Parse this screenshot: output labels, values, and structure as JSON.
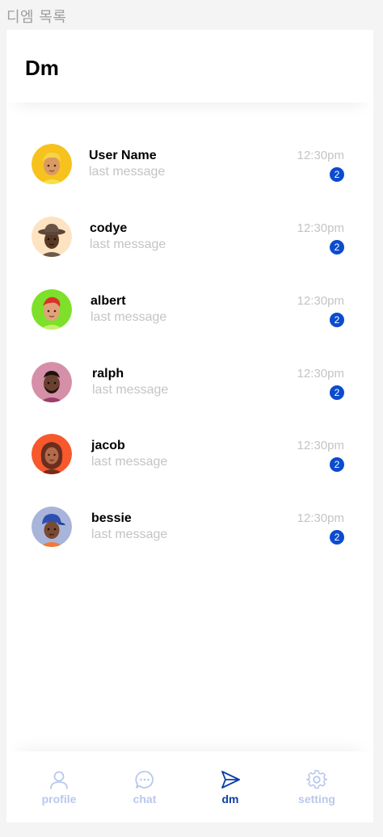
{
  "frame_label": "디엠 목록",
  "header": {
    "title": "Dm"
  },
  "conversations": [
    {
      "name": "User Name",
      "last_message": "last message",
      "time": "12:30pm",
      "unread": "2"
    },
    {
      "name": "codye",
      "last_message": "last message",
      "time": "12:30pm",
      "unread": "2"
    },
    {
      "name": "albert",
      "last_message": "last message",
      "time": "12:30pm",
      "unread": "2"
    },
    {
      "name": "ralph",
      "last_message": "last message",
      "time": "12:30pm",
      "unread": "2"
    },
    {
      "name": "jacob",
      "last_message": "last message",
      "time": "12:30pm",
      "unread": "2"
    },
    {
      "name": "bessie",
      "last_message": "last message",
      "time": "12:30pm",
      "unread": "2"
    }
  ],
  "nav": {
    "items": [
      {
        "label": "profile",
        "icon": "user-icon",
        "active": false
      },
      {
        "label": "chat",
        "icon": "chat-bubble-icon",
        "active": false
      },
      {
        "label": "dm",
        "icon": "paper-plane-icon",
        "active": true
      },
      {
        "label": "setting",
        "icon": "gear-icon",
        "active": false
      }
    ]
  },
  "colors": {
    "accent": "#0b4bcf",
    "nav_active": "#0b3ea8",
    "nav_inactive": "#b9c8ec",
    "muted_text": "#c4c4c4",
    "avatar_backgrounds": [
      "#f7c21e",
      "#fde3c2",
      "#7ee02b",
      "#d68fa8",
      "#f7582c",
      "#a9b4db"
    ]
  }
}
